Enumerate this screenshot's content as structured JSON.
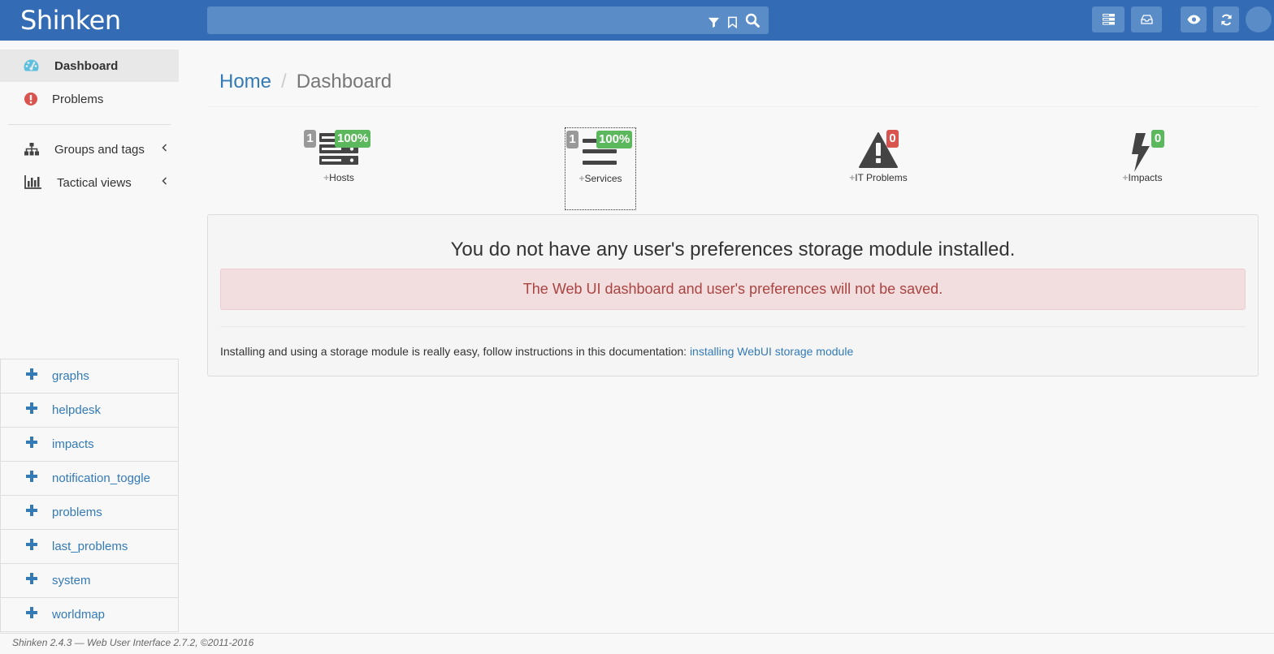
{
  "app": {
    "logo": "Shinken"
  },
  "header": {
    "search": {
      "placeholder": ""
    },
    "icons": [
      "filter-icon",
      "bookmark-icon",
      "search-icon",
      "server-icon",
      "inbox-icon",
      "eye-icon",
      "refresh-icon",
      "user-avatar"
    ]
  },
  "sidebar": {
    "items": [
      {
        "label": "Dashboard",
        "icon": "dashboard-icon",
        "active": true
      },
      {
        "label": "Problems",
        "icon": "exclamation-circle-icon"
      },
      {
        "label": "Groups and tags",
        "icon": "sitemap-icon"
      },
      {
        "label": "Tactical views",
        "icon": "bar-chart-icon"
      }
    ],
    "extensions": [
      "graphs",
      "helpdesk",
      "impacts",
      "notification_toggle",
      "problems",
      "last_problems",
      "system",
      "worldmap"
    ]
  },
  "breadcrumb": {
    "home": "Home",
    "separator": "/",
    "current": "Dashboard"
  },
  "stats": [
    {
      "label": "Hosts",
      "count": "1",
      "percent": "100%"
    },
    {
      "label": "Services",
      "count": "1",
      "percent": "100%"
    },
    {
      "label": "IT Problems",
      "count": "0"
    },
    {
      "label": "Impacts",
      "count": "0"
    }
  ],
  "panel": {
    "title": "You do not have any user's preferences storage module installed.",
    "alert": "The Web UI dashboard and user's preferences will not be saved.",
    "info_text": "Installing and using a storage module is really easy, follow instructions in this documentation: ",
    "info_link": "installing WebUI storage module"
  },
  "footer": {
    "text": "Shinken 2.4.3 — Web User Interface 2.7.2, ©2011-2016"
  },
  "colors": {
    "topbar": "#336bb4",
    "link": "#337ab7",
    "success": "#5cb85c",
    "danger": "#d9534f"
  }
}
